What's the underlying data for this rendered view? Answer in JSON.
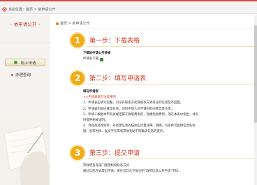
{
  "breadcrumb_top": "当前位置：首页 > 依申请公开",
  "sidebar": {
    "title": "依申请公开",
    "button_label": "网上申请",
    "link_label": "办理查询"
  },
  "content": {
    "breadcrumb": "首页 > 依申请公开",
    "steps": [
      {
        "number": "1",
        "title": "第一步：下载表格",
        "lines": [
          "下载依申请公开表格",
          "申请表下载"
        ]
      },
      {
        "number": "2",
        "title": "第二步：填写申请表",
        "lines": [
          "填写申请表",
          "××申请表填写注意事项",
          "1、申请表应填写完整，对没有联系方式或联系方式有误的信息恕不回复。",
          "2、申请表内容应真实有效，同时申请人对申请材料的真实性负责。",
          "3、申请人根据本市有关规定属于收取费用的，免缴免除费用，须在本表中指出，并同",
          "时提供相关证明。",
          "4、为提高处理效率，对所需信息的描述应尽量详细、明确，有条件可提供信息的标",
          "题、发布时间、发文字号或者其他有助于明确该信息的提示。"
        ]
      },
      {
        "number": "3",
        "title": "第三步：提交申请",
        "lines": [
          "市政府及各部门受理机构联系方式",
          "通过信函方式提出申请，请在信封左下角注明“政府信息公开申请”字样。"
        ]
      }
    ]
  },
  "colors": {
    "accent_red": "#d63b24",
    "step_badge": "#f0ad18",
    "sidebar_bg": "#f6f4f1"
  }
}
